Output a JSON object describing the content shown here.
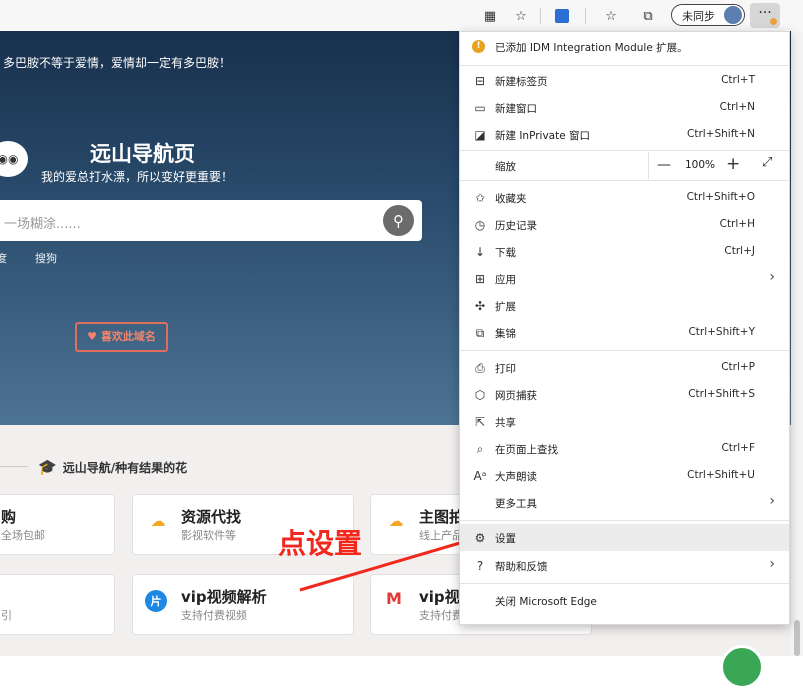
{
  "toolbar": {
    "sync_label": "未同步",
    "more_label": "···"
  },
  "hero": {
    "tip": "多巴胺不等于爱情，爱情却一定有多巴胺！",
    "title": "远山导航页",
    "subtitle": "我的爱总打水漂，所以变好更重要！",
    "search_placeholder": "一场糊涂......",
    "engines": [
      "度",
      "搜狗"
    ],
    "like_label": "♥ 喜欢此域名"
  },
  "section": {
    "title": "远山导航/种有结果的花"
  },
  "cards": [
    {
      "title": "购",
      "desc": "全场包邮"
    },
    {
      "title": "资源代找",
      "desc": "影视软件等"
    },
    {
      "title": "主图拍",
      "desc": "线上产品"
    },
    {
      "title": "",
      "desc": "引"
    },
    {
      "title": "vip视频解析",
      "desc": "支持付费视频"
    },
    {
      "title": "vip视",
      "desc": "支持付费"
    }
  ],
  "annotation": "点设置",
  "menu": {
    "notice": "已添加 IDM Integration Module 扩展。",
    "items": [
      {
        "label": "新建标签页",
        "shortcut": "Ctrl+T"
      },
      {
        "label": "新建窗口",
        "shortcut": "Ctrl+N"
      },
      {
        "label": "新建 InPrivate 窗口",
        "shortcut": "Ctrl+Shift+N"
      },
      {
        "label": "缩放",
        "shortcut": ""
      },
      {
        "label": "收藏夹",
        "shortcut": "Ctrl+Shift+O"
      },
      {
        "label": "历史记录",
        "shortcut": "Ctrl+H"
      },
      {
        "label": "下载",
        "shortcut": "Ctrl+J"
      },
      {
        "label": "应用",
        "shortcut": ""
      },
      {
        "label": "扩展",
        "shortcut": ""
      },
      {
        "label": "集锦",
        "shortcut": "Ctrl+Shift+Y"
      },
      {
        "label": "打印",
        "shortcut": "Ctrl+P"
      },
      {
        "label": "网页捕获",
        "shortcut": "Ctrl+Shift+S"
      },
      {
        "label": "共享",
        "shortcut": ""
      },
      {
        "label": "在页面上查找",
        "shortcut": "Ctrl+F"
      },
      {
        "label": "大声朗读",
        "shortcut": "Ctrl+Shift+U"
      },
      {
        "label": "更多工具",
        "shortcut": ""
      },
      {
        "label": "设置",
        "shortcut": ""
      },
      {
        "label": "帮助和反馈",
        "shortcut": ""
      },
      {
        "label": "关闭 Microsoft Edge",
        "shortcut": ""
      }
    ],
    "zoom": {
      "minus": "—",
      "value": "100%",
      "plus": "+",
      "fullscreen": "⤢"
    }
  }
}
